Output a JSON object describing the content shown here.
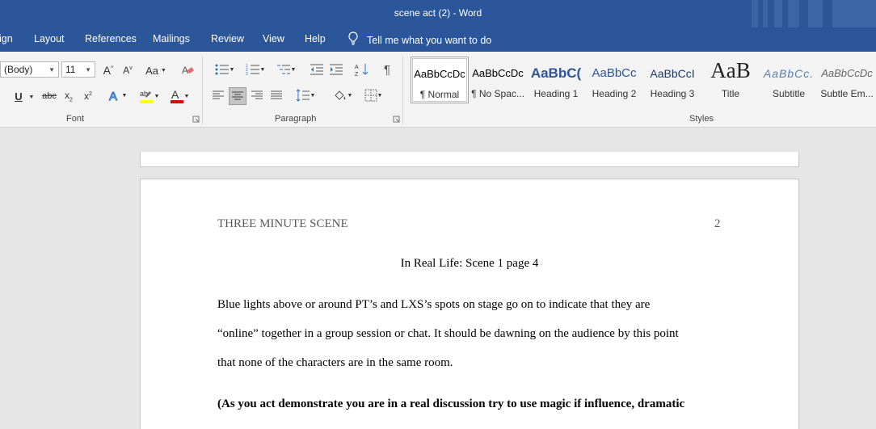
{
  "window": {
    "title": "scene act (2)  -  Word"
  },
  "menu": {
    "tabs": [
      "ign",
      "Layout",
      "References",
      "Mailings",
      "Review",
      "View",
      "Help"
    ],
    "tell_me": "Tell me what you want to do"
  },
  "ribbon": {
    "font": {
      "name": "(Body)",
      "size": "11",
      "label": "Font",
      "change_case": "Aa"
    },
    "paragraph": {
      "label": "Paragraph"
    },
    "styles": {
      "label": "Styles",
      "items": [
        {
          "sample": "AaBbCcDc",
          "name": "¶ Normal"
        },
        {
          "sample": "AaBbCcDc",
          "name": "¶ No Spac..."
        },
        {
          "sample": "AaBbC(",
          "name": "Heading 1"
        },
        {
          "sample": "AaBbCc",
          "name": "Heading 2"
        },
        {
          "sample": "AaBbCcI",
          "name": "Heading 3"
        },
        {
          "sample": "AaB",
          "name": "Title"
        },
        {
          "sample": "AaBbCc.",
          "name": "Subtitle"
        },
        {
          "sample": "AaBbCcDc",
          "name": "Subtle Em..."
        }
      ]
    }
  },
  "colors": {
    "brand": "#2b579a",
    "highlight": "#ffff00",
    "font_color": "#e00000"
  },
  "document": {
    "header_left": "THREE MINUTE SCENE",
    "page_number": "2",
    "heading": "In Real Life: Scene 1 page 4",
    "para1_lines": [
      "Blue lights above or around PT’s and LXS’s spots on stage go on to indicate that they are",
      "“online” together in a group session or chat. It should be dawning on the audience by this point",
      "that none of the characters are in the same room."
    ],
    "bold_line": "(As you act demonstrate you are in a real discussion try to use magic if influence, dramatic"
  }
}
